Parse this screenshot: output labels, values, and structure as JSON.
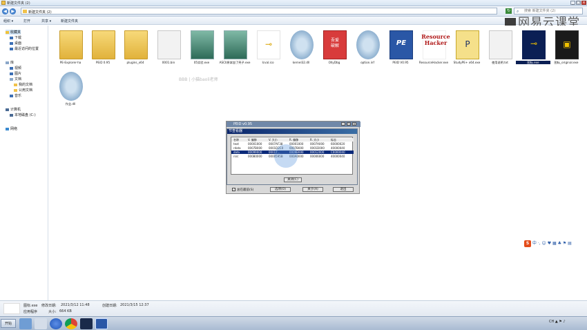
{
  "window": {
    "title": "新建文件夹 (2)",
    "controls": [
      "_",
      "□",
      "×"
    ]
  },
  "address": {
    "path": "新建文件夹 (2)",
    "search_placeholder": "搜索 新建文件夹 (2)"
  },
  "toolbar": {
    "organize": "组织 ▾",
    "open": "打开",
    "share": "共享 ▾",
    "new_folder": "新建文件夹"
  },
  "watermark": "网易云课堂",
  "nav": {
    "favorites_header": "收藏夹",
    "favorites": [
      "下载",
      "桌面",
      "最近访问的位置"
    ],
    "libraries_header": "库",
    "libraries": [
      "视频",
      "图片",
      "文档",
      "我的文档",
      "公用文档",
      "音乐"
    ],
    "computer_header": "计算机",
    "computer": [
      "本地磁盘 (C:)"
    ],
    "network": "网络"
  },
  "files": [
    {
      "label": "PE-Explorer-ha",
      "icon": "folder"
    },
    {
      "label": "PEiD 0.95",
      "icon": "folder"
    },
    {
      "label": "plugins_x64",
      "icon": "folder"
    },
    {
      "label": "0001.bin",
      "icon": "doc"
    },
    {
      "label": "05实验.exe",
      "icon": "img"
    },
    {
      "label": "ASCII原本加了壳子.exe",
      "icon": "img"
    },
    {
      "label": "Icval.ico",
      "icon": "key"
    },
    {
      "label": "kernel32.dll",
      "icon": "gear"
    },
    {
      "label": "OllyDbg",
      "icon": "red"
    },
    {
      "label": "option.inf",
      "icon": "gear"
    },
    {
      "label": "PEID V0.95",
      "icon": "pe"
    },
    {
      "label": "ResourceHacker.exe",
      "icon": "rh"
    },
    {
      "label": "StudyPE+ x64.exe",
      "icon": "yellow"
    },
    {
      "label": "使用说明.txt",
      "icon": "doc"
    },
    {
      "label": "图标.exe",
      "icon": "key-selected"
    },
    {
      "label": "图标_original.exe",
      "icon": "dark"
    },
    {
      "label": "作业.dll",
      "icon": "gear"
    }
  ],
  "overlay_text": "BBB | 小猫baoli老师",
  "peid_dialog": {
    "title": "PEiD v0.95",
    "inner_title": "节查看器",
    "columns": [
      "名称",
      "V. 偏移",
      "V. 大小",
      "R. 偏移",
      "R. 大小",
      "标志"
    ],
    "rows": [
      [
        "text",
        "00001000",
        "0007AF38",
        "00001000",
        "0007A000",
        "60000020"
      ],
      [
        "rdata",
        "0007B000",
        "0001D2C0",
        "0007B000",
        "0001D000",
        "40000040"
      ],
      [
        "data",
        "00099000",
        "00017...",
        "0009B000",
        "00012000",
        "C0000040"
      ],
      [
        "rsrc",
        "000B0000",
        "0000595B",
        "000A0000",
        "00006000",
        "40000040"
      ]
    ],
    "selected_row": 2,
    "close_button": "关闭(C)",
    "always_on_top": "总在最前(S)",
    "options_button": "选项(O)",
    "about_button": "关于(A)",
    "exit_button": "退出"
  },
  "details": {
    "name_label": "图标.exe",
    "modified_label": "修改日期:",
    "modified_value": "2021/3/12 11:48",
    "created_label": "创建日期:",
    "created_value": "2021/3/15 12:37",
    "type_label": "应用程序",
    "size_label": "大小:",
    "size_value": "664 KB"
  },
  "taskbar": {
    "start": "开始",
    "apps": [
      "explorer",
      "media",
      "sogou",
      "chrome",
      "studype",
      "peid"
    ],
    "tray": "CH"
  },
  "ime": "中 ·, ☺ ♥ ▦ ♣ ⚑ ▤"
}
